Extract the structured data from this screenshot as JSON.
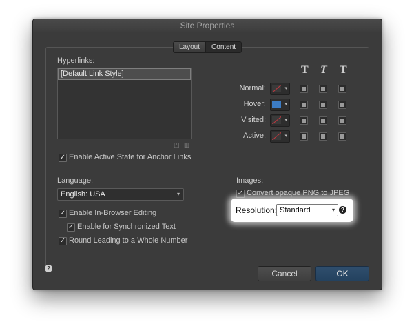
{
  "dialog": {
    "title": "Site Properties"
  },
  "tabs": [
    {
      "label": "Layout",
      "active": false
    },
    {
      "label": "Content",
      "active": true
    }
  ],
  "hyperlinks": {
    "label": "Hyperlinks:",
    "items": [
      "[Default Link Style]"
    ],
    "enable_active_state_label": "Enable Active State for Anchor Links",
    "enable_active_state_checked": true
  },
  "format": {
    "headers": [
      "T",
      "T",
      "T"
    ],
    "rows": [
      {
        "label": "Normal:",
        "swatch": "none"
      },
      {
        "label": "Hover:",
        "swatch": "blue"
      },
      {
        "label": "Visited:",
        "swatch": "none"
      },
      {
        "label": "Active:",
        "swatch": "none"
      }
    ]
  },
  "language": {
    "label": "Language:",
    "selected": "English: USA",
    "enable_in_browser_label": "Enable In-Browser Editing",
    "enable_in_browser_checked": true,
    "enable_sync_label": "Enable for Synchronized Text",
    "enable_sync_checked": true,
    "round_leading_label": "Round Leading to a Whole Number",
    "round_leading_checked": true
  },
  "images": {
    "label": "Images:",
    "convert_label": "Convert opaque PNG to JPEG",
    "convert_checked": true,
    "resolution_label": "Resolution:",
    "resolution_selected": "Standard"
  },
  "buttons": {
    "cancel": "Cancel",
    "ok": "OK"
  },
  "icons": {
    "help": "?",
    "check": "✓",
    "caret": "▾"
  }
}
